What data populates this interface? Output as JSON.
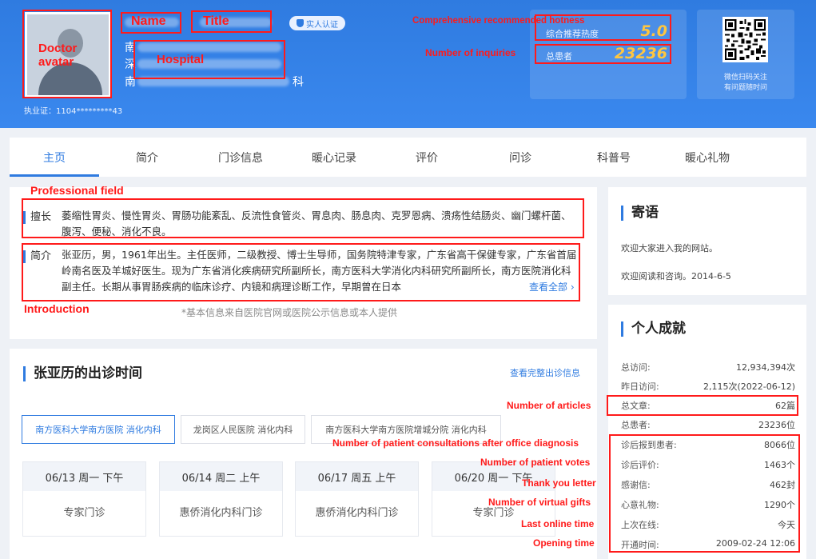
{
  "header": {
    "license": "执业证：1104*********43",
    "badge_label": "实人认证",
    "name_lines_prefix": [
      "南",
      "深",
      "南"
    ],
    "name_line_suffix": "科",
    "recommend_label": "综合推荐热度",
    "recommend_value": "5.0",
    "patients_label": "总患者",
    "patients_value": "23236",
    "qr_caption_1": "微信扫码关注",
    "qr_caption_2": "有问题随时问"
  },
  "tabs": [
    "主页",
    "简介",
    "门诊信息",
    "暖心记录",
    "评价",
    "问诊",
    "科普号",
    "暖心礼物"
  ],
  "profile": {
    "specialty_label": "擅长",
    "specialty_text": "萎缩性胃炎、慢性胃炎、胃肠功能紊乱、反流性食管炎、胃息肉、肠息肉、克罗恩病、溃疡性结肠炎、幽门螺杆菌、腹泻、便秘、消化不良。",
    "intro_label": "简介",
    "intro_text": "张亚历，男，1961年出生。主任医师，二级教授、博士生导师，国务院特津专家，广东省高干保健专家，广东省首届岭南名医及羊城好医生。现为广东省消化疾病研究所副所长，南方医科大学消化内科研究所副所长，南方医院消化科副主任。长期从事胃肠疾病的临床诊疗、内镜和病理诊断工作，早期曾在日本",
    "more_link": "查看全部",
    "source_note": "*基本信息来自医院官网或医院公示信息或本人提供"
  },
  "schedule": {
    "title": "张亚历的出诊时间",
    "view_all": "查看完整出诊信息",
    "hospitals": [
      "南方医科大学南方医院 消化内科",
      "龙岗区人民医院 消化内科",
      "南方医科大学南方医院增城分院 消化内科"
    ],
    "slots": [
      {
        "date": "06/13 周一 下午",
        "type": "专家门诊"
      },
      {
        "date": "06/14 周二 上午",
        "type": "惠侨消化内科门诊"
      },
      {
        "date": "06/17 周五 上午",
        "type": "惠侨消化内科门诊"
      },
      {
        "date": "06/20 周一 下午",
        "type": "专家门诊"
      }
    ]
  },
  "greeting": {
    "title": "寄语",
    "line1": "欢迎大家进入我的网站。",
    "line2": "欢迎阅读和咨询。2014-6-5"
  },
  "achievements": {
    "title": "个人成就",
    "rows": [
      {
        "k": "总访问:",
        "v": "12,934,394次"
      },
      {
        "k": "昨日访问:",
        "v": "2,115次(2022-06-12)"
      },
      {
        "k": "总文章:",
        "v": "62篇"
      },
      {
        "k": "总患者:",
        "v": "23236位"
      },
      {
        "k": "诊后报到患者:",
        "v": "8066位"
      },
      {
        "k": "诊后评价:",
        "v": "1463个"
      },
      {
        "k": "感谢信:",
        "v": "462封"
      },
      {
        "k": "心意礼物:",
        "v": "1290个"
      },
      {
        "k": "上次在线:",
        "v": "今天"
      },
      {
        "k": "开通时间:",
        "v": "2009-02-24 12:06"
      }
    ]
  },
  "annotations": {
    "avatar": "Doctor\navatar",
    "name": "Name",
    "title": "Title",
    "hospital": "Hospital",
    "hotness": "Comprehensive recommended hotness",
    "inquiries": "Number of inquiries",
    "professional_field": "Professional field",
    "introduction": "Introduction",
    "articles": "Number of articles",
    "consultations": "Number of patient consultations after office diagnosis",
    "votes": "Number of patient votes",
    "thank_you": "Thank you letter",
    "gifts": "Number of virtual gifts",
    "last_online": "Last online time",
    "opening_time": "Opening time"
  },
  "colors": {
    "header_blue": "#2f7be0",
    "accent_blue": "#2f7be0",
    "hotness_gold": "#ffc640",
    "annotation_red": "#ff1a1a"
  }
}
